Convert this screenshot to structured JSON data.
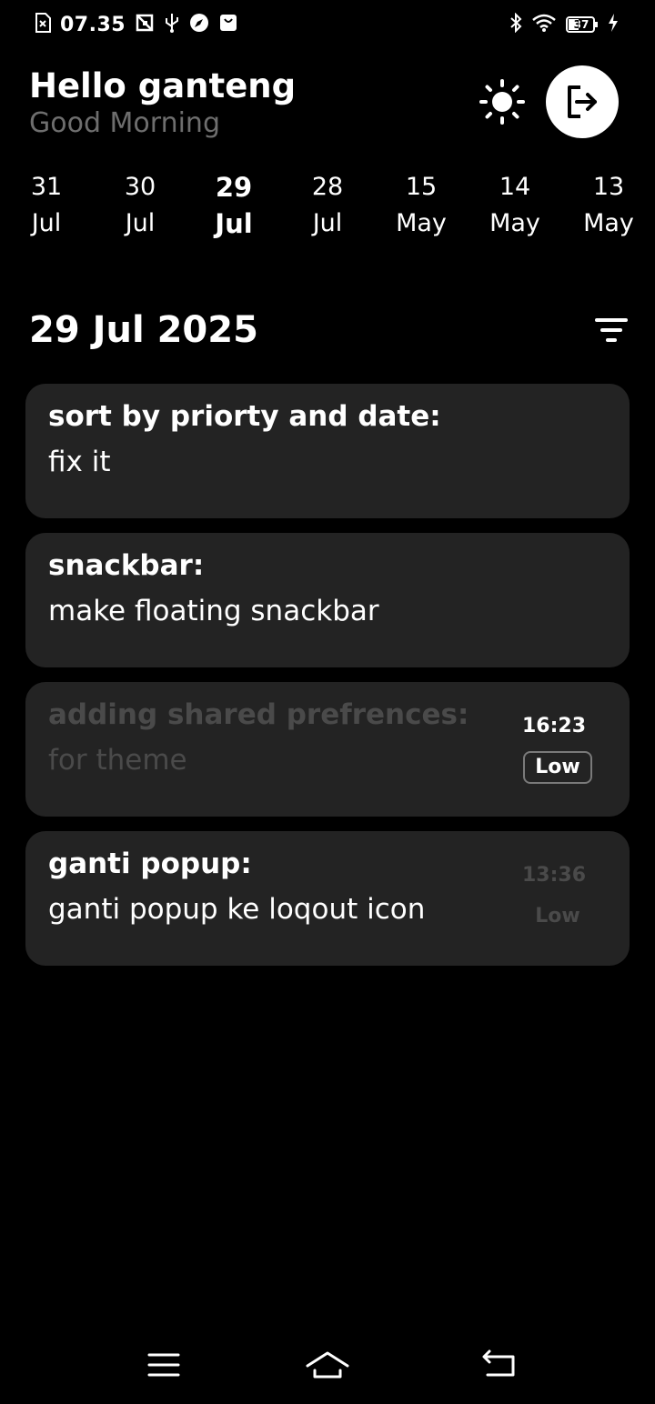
{
  "status_bar": {
    "time": "07.35",
    "battery": "37",
    "left_icons": [
      "no-sim-icon",
      "screenshot-icon",
      "usb-icon",
      "compass-icon",
      "shopping-bag-icon"
    ],
    "right_icons": [
      "bluetooth-icon",
      "wifi-icon",
      "battery-icon",
      "charging-icon"
    ]
  },
  "header": {
    "greeting": "Hello ganteng",
    "subtitle": "Good Morning",
    "theme_icon": "sun-icon",
    "logout_icon": "logout-icon"
  },
  "dates": [
    {
      "day": "31",
      "month": "Jul",
      "selected": false
    },
    {
      "day": "30",
      "month": "Jul",
      "selected": false
    },
    {
      "day": "29",
      "month": "Jul",
      "selected": true
    },
    {
      "day": "28",
      "month": "Jul",
      "selected": false
    },
    {
      "day": "15",
      "month": "May",
      "selected": false
    },
    {
      "day": "14",
      "month": "May",
      "selected": false
    },
    {
      "day": "13",
      "month": "May",
      "selected": false
    }
  ],
  "section": {
    "title": "29 Jul 2025",
    "filter_icon": "filter-icon"
  },
  "tasks": [
    {
      "title": "sort by priorty and date:",
      "description": "fix it",
      "time": "",
      "priority": ""
    },
    {
      "title": "snackbar:",
      "description": "make floating snackbar",
      "time": "",
      "priority": ""
    },
    {
      "title": "adding shared prefrences:",
      "description": "for theme",
      "time": "16:23",
      "priority": "Low"
    },
    {
      "title": "ganti popup:",
      "description": "ganti popup ke loqout icon",
      "time": "13:36",
      "priority": "Low"
    }
  ],
  "colors": {
    "background": "#000000",
    "card": "#232323",
    "muted_text": "#6e6e6e",
    "dim_text": "#4a4a4a"
  },
  "nav_bar": {
    "icons": [
      "menu-icon",
      "home-icon",
      "back-icon"
    ]
  }
}
